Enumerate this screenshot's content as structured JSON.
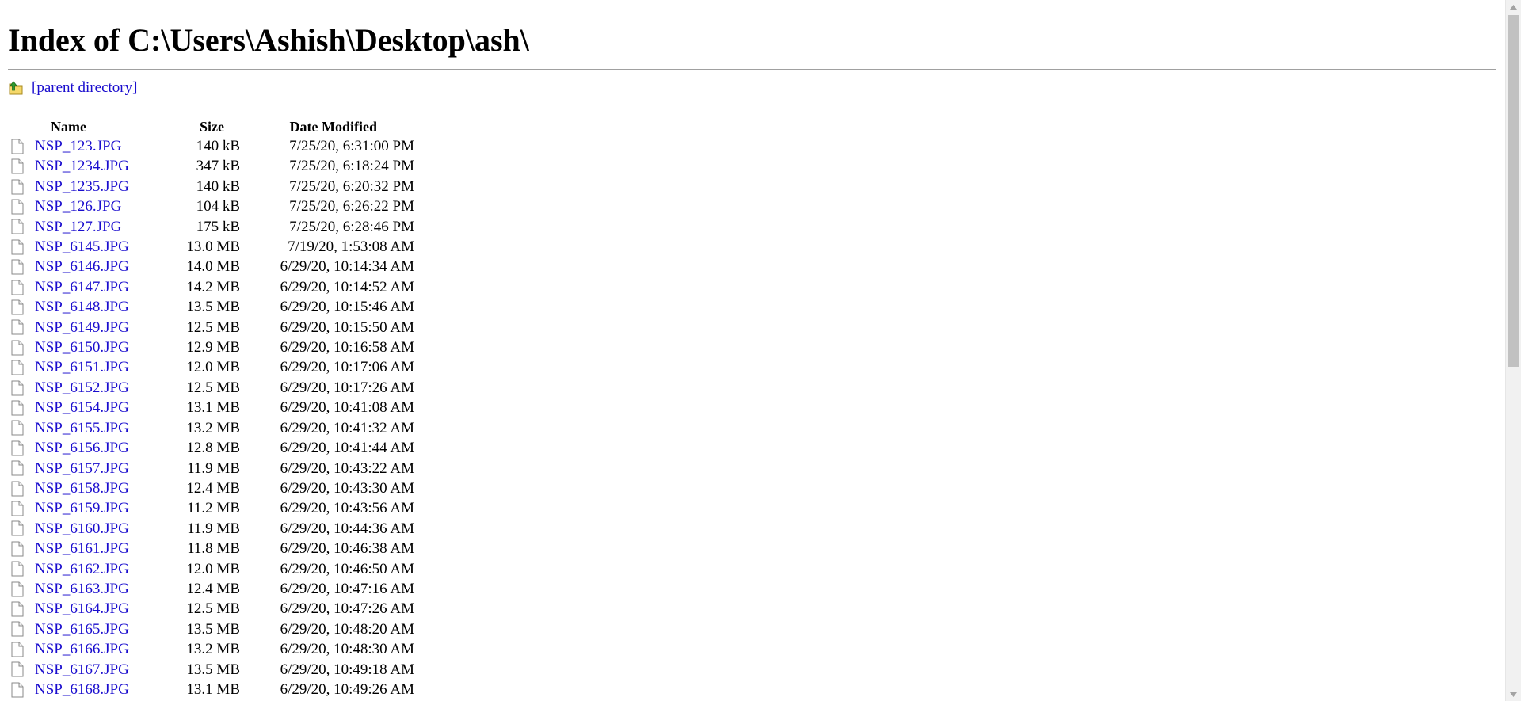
{
  "page": {
    "title": "Index of C:\\Users\\Ashish\\Desktop\\ash\\",
    "parent_link": "[parent directory]"
  },
  "table": {
    "headers": {
      "name": "Name",
      "size": "Size",
      "date": "Date Modified"
    },
    "rows": [
      {
        "name": "NSP_123.JPG",
        "size": "140 kB",
        "date": "7/25/20, 6:31:00 PM"
      },
      {
        "name": "NSP_1234.JPG",
        "size": "347 kB",
        "date": "7/25/20, 6:18:24 PM"
      },
      {
        "name": "NSP_1235.JPG",
        "size": "140 kB",
        "date": "7/25/20, 6:20:32 PM"
      },
      {
        "name": "NSP_126.JPG",
        "size": "104 kB",
        "date": "7/25/20, 6:26:22 PM"
      },
      {
        "name": "NSP_127.JPG",
        "size": "175 kB",
        "date": "7/25/20, 6:28:46 PM"
      },
      {
        "name": "NSP_6145.JPG",
        "size": "13.0 MB",
        "date": "7/19/20, 1:53:08 AM"
      },
      {
        "name": "NSP_6146.JPG",
        "size": "14.0 MB",
        "date": "6/29/20, 10:14:34 AM"
      },
      {
        "name": "NSP_6147.JPG",
        "size": "14.2 MB",
        "date": "6/29/20, 10:14:52 AM"
      },
      {
        "name": "NSP_6148.JPG",
        "size": "13.5 MB",
        "date": "6/29/20, 10:15:46 AM"
      },
      {
        "name": "NSP_6149.JPG",
        "size": "12.5 MB",
        "date": "6/29/20, 10:15:50 AM"
      },
      {
        "name": "NSP_6150.JPG",
        "size": "12.9 MB",
        "date": "6/29/20, 10:16:58 AM"
      },
      {
        "name": "NSP_6151.JPG",
        "size": "12.0 MB",
        "date": "6/29/20, 10:17:06 AM"
      },
      {
        "name": "NSP_6152.JPG",
        "size": "12.5 MB",
        "date": "6/29/20, 10:17:26 AM"
      },
      {
        "name": "NSP_6154.JPG",
        "size": "13.1 MB",
        "date": "6/29/20, 10:41:08 AM"
      },
      {
        "name": "NSP_6155.JPG",
        "size": "13.2 MB",
        "date": "6/29/20, 10:41:32 AM"
      },
      {
        "name": "NSP_6156.JPG",
        "size": "12.8 MB",
        "date": "6/29/20, 10:41:44 AM"
      },
      {
        "name": "NSP_6157.JPG",
        "size": "11.9 MB",
        "date": "6/29/20, 10:43:22 AM"
      },
      {
        "name": "NSP_6158.JPG",
        "size": "12.4 MB",
        "date": "6/29/20, 10:43:30 AM"
      },
      {
        "name": "NSP_6159.JPG",
        "size": "11.2 MB",
        "date": "6/29/20, 10:43:56 AM"
      },
      {
        "name": "NSP_6160.JPG",
        "size": "11.9 MB",
        "date": "6/29/20, 10:44:36 AM"
      },
      {
        "name": "NSP_6161.JPG",
        "size": "11.8 MB",
        "date": "6/29/20, 10:46:38 AM"
      },
      {
        "name": "NSP_6162.JPG",
        "size": "12.0 MB",
        "date": "6/29/20, 10:46:50 AM"
      },
      {
        "name": "NSP_6163.JPG",
        "size": "12.4 MB",
        "date": "6/29/20, 10:47:16 AM"
      },
      {
        "name": "NSP_6164.JPG",
        "size": "12.5 MB",
        "date": "6/29/20, 10:47:26 AM"
      },
      {
        "name": "NSP_6165.JPG",
        "size": "13.5 MB",
        "date": "6/29/20, 10:48:20 AM"
      },
      {
        "name": "NSP_6166.JPG",
        "size": "13.2 MB",
        "date": "6/29/20, 10:48:30 AM"
      },
      {
        "name": "NSP_6167.JPG",
        "size": "13.5 MB",
        "date": "6/29/20, 10:49:18 AM"
      },
      {
        "name": "NSP_6168.JPG",
        "size": "13.1 MB",
        "date": "6/29/20, 10:49:26 AM"
      }
    ]
  },
  "icons": {
    "parent": "folder-up-icon",
    "file": "file-icon"
  },
  "colors": {
    "link": "#1a0dce",
    "rule": "#a0a0a0",
    "scrollbar_track": "#f1f1f1",
    "scrollbar_thumb": "#c1c1c1"
  }
}
